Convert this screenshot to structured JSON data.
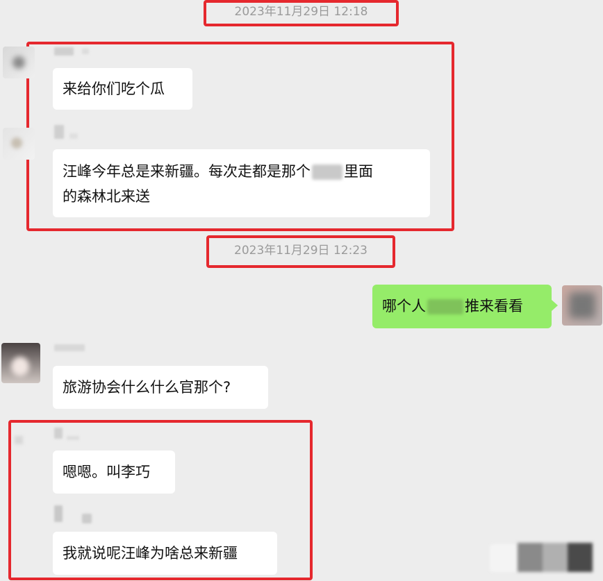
{
  "timestamps": [
    "2023年11月29日 12:18",
    "2023年11月29日 12:23"
  ],
  "messages": [
    {
      "side": "left",
      "text": "来给你们吃个瓜"
    },
    {
      "side": "left",
      "text_line1_before": "汪峰今年总是来新疆。每次走都是那个",
      "text_line1_after": "里面",
      "text_line2": "的森林北来送"
    },
    {
      "side": "right",
      "text_before": "哪个人",
      "text_after": "推来看看"
    },
    {
      "side": "left",
      "text": "旅游协会什么什么官那个?"
    },
    {
      "side": "left",
      "text": "嗯嗯。叫李巧"
    },
    {
      "side": "left",
      "text": "我就说呢汪峰为啥总来新疆"
    }
  ],
  "colors": {
    "background": "#ededed",
    "bubble_left": "#ffffff",
    "bubble_right": "#95ec69",
    "highlight": "#e5282e",
    "timestamp_text": "#9a9a9a"
  }
}
